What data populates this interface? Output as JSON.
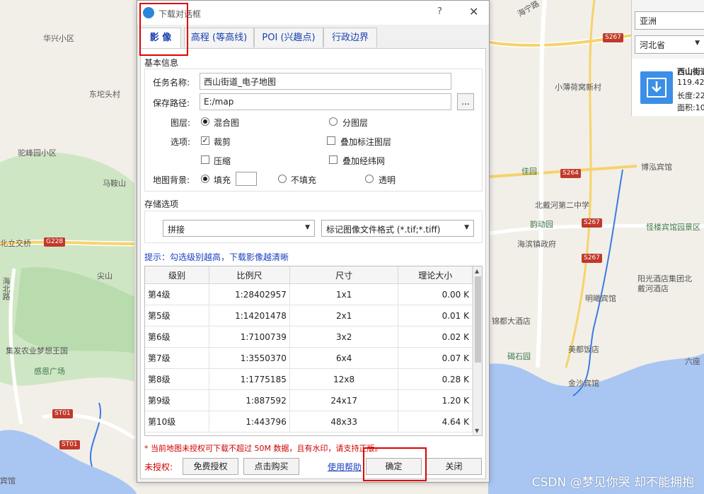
{
  "map": {
    "labels": [
      "华兴小区",
      "东坨头村",
      "驼峰园小区",
      "马鞍山",
      "北立交桥",
      "尖山",
      "海北路",
      "集发农业梦想王国",
      "感恩广场",
      "海宁路",
      "小薄荷窝新村",
      "佳园",
      "博泓宾馆",
      "北戴河第二中学",
      "韵动园",
      "怪楼宾馆园景区",
      "海滨镇政府",
      "阳光酒店集团北戴河酒店",
      "明曦宾馆",
      "锦都大酒店",
      "碣石园",
      "美都饭店",
      "六座",
      "金沙宾馆",
      "宾馆"
    ],
    "shields": [
      "S267",
      "S264",
      "S267",
      "S267",
      "G228",
      "ST01",
      "ST01"
    ],
    "watermark": "CSDN @梦见你哭 却不能拥抱"
  },
  "region_panel": {
    "continent": "亚洲",
    "province": "河北省",
    "place_name": "西山街道",
    "coord_value": "119.42",
    "length_label": "长度:22",
    "area_label": "面积:10"
  },
  "dialog": {
    "title": "下载对话框",
    "help": "?",
    "close": "✕",
    "tabs": [
      "影 像",
      "高程 (等高线)",
      "POI (兴趣点)",
      "行政边界"
    ],
    "basic": {
      "section_title": "基本信息",
      "task_label": "任务名称:",
      "task_value": "西山街道_电子地图",
      "path_label": "保存路径:",
      "path_value": "E:/map",
      "browse": "...",
      "layer_label": "图层:",
      "layer_opt1": "混合图",
      "layer_opt2": "分图层",
      "options_label": "选项:",
      "opt_crop": "裁剪",
      "opt_overlay": "叠加标注图层",
      "opt_compress": "压缩",
      "opt_grid": "叠加经纬网",
      "bg_label": "地图背景:",
      "bg_fill": "填充",
      "bg_nofill": "不填充",
      "bg_transparent": "透明"
    },
    "storage": {
      "section_title": "存储选项",
      "mode": "拼接",
      "format": "标记图像文件格式 (*.tif;*.tiff)"
    },
    "hint": "提示：勾选级别越高，下载影像越清晰",
    "table": {
      "headers": [
        "级别",
        "比例尺",
        "尺寸",
        "理论大小"
      ],
      "rows": [
        [
          "第4级",
          "1:28402957",
          "1x1",
          "0.00 K"
        ],
        [
          "第5级",
          "1:14201478",
          "2x1",
          "0.01 K"
        ],
        [
          "第6级",
          "1:7100739",
          "3x2",
          "0.02 K"
        ],
        [
          "第7级",
          "1:3550370",
          "6x4",
          "0.07 K"
        ],
        [
          "第8级",
          "1:1775185",
          "12x8",
          "0.28 K"
        ],
        [
          "第9级",
          "1:887592",
          "24x17",
          "1.20 K"
        ],
        [
          "第10级",
          "1:443796",
          "48x33",
          "4.64 K"
        ]
      ]
    },
    "warning": "* 当前地图未授权可下载不超过 50M 数据，且有水印，请支持正版。",
    "footer": {
      "unlicensed": "未授权:",
      "free": "免费授权",
      "buy": "点击购买",
      "help": "使用帮助",
      "ok": "确定",
      "close": "关闭"
    }
  }
}
